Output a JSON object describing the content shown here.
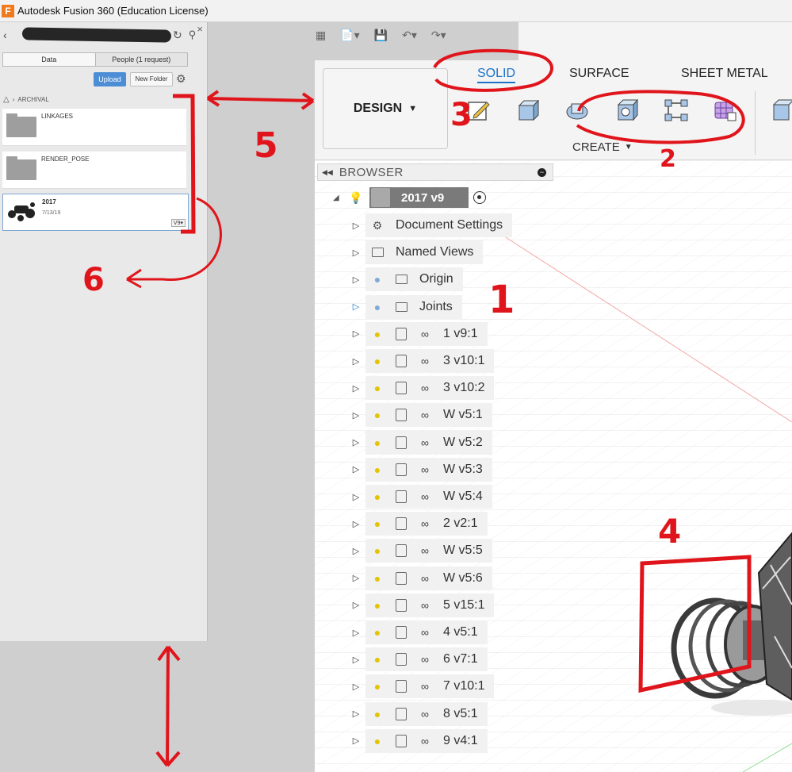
{
  "window": {
    "title": "Autodesk Fusion 360 (Education License)",
    "logo": "F"
  },
  "data_panel": {
    "tabs": [
      "Data",
      "People (1 request)"
    ],
    "upload_label": "Upload",
    "new_folder_label": "New Folder",
    "breadcrumb": "ARCHIVAL",
    "folders": [
      "LINKAGES",
      "RENDER_POSE"
    ],
    "design": {
      "name": "2017",
      "date": "7/13/19",
      "version": "V9▾"
    }
  },
  "toolbar": {
    "workspace_label": "DESIGN",
    "tabs": [
      "SOLID",
      "SURFACE",
      "SHEET METAL"
    ],
    "active_tab": "SOLID",
    "create_label": "CREATE"
  },
  "browser": {
    "title": "BROWSER",
    "root": "2017 v9",
    "nodes": [
      {
        "label": "Document Settings",
        "kind": "settings"
      },
      {
        "label": "Named Views",
        "kind": "folder"
      },
      {
        "label": "Origin",
        "kind": "folder-bulb"
      },
      {
        "label": "Joints",
        "kind": "folder-bulb"
      },
      {
        "label": "1 v9:1",
        "kind": "component"
      },
      {
        "label": "3 v10:1",
        "kind": "component"
      },
      {
        "label": "3 v10:2",
        "kind": "component"
      },
      {
        "label": "W v5:1",
        "kind": "component"
      },
      {
        "label": "W v5:2",
        "kind": "component"
      },
      {
        "label": "W v5:3",
        "kind": "component"
      },
      {
        "label": "W v5:4",
        "kind": "component"
      },
      {
        "label": "2 v2:1",
        "kind": "component"
      },
      {
        "label": "W v5:5",
        "kind": "component"
      },
      {
        "label": "W v5:6",
        "kind": "component"
      },
      {
        "label": "5 v15:1",
        "kind": "component"
      },
      {
        "label": "4 v5:1",
        "kind": "component"
      },
      {
        "label": "6 v7:1",
        "kind": "component"
      },
      {
        "label": "7 v10:1",
        "kind": "component"
      },
      {
        "label": "8 v5:1",
        "kind": "component"
      },
      {
        "label": "9 v4:1",
        "kind": "component"
      }
    ]
  },
  "annotations": [
    "1",
    "2",
    "3",
    "4",
    "5",
    "6"
  ],
  "colors": {
    "accent": "#1a72c9",
    "annotation": "#e0151c",
    "upload": "#4b8ed6"
  }
}
